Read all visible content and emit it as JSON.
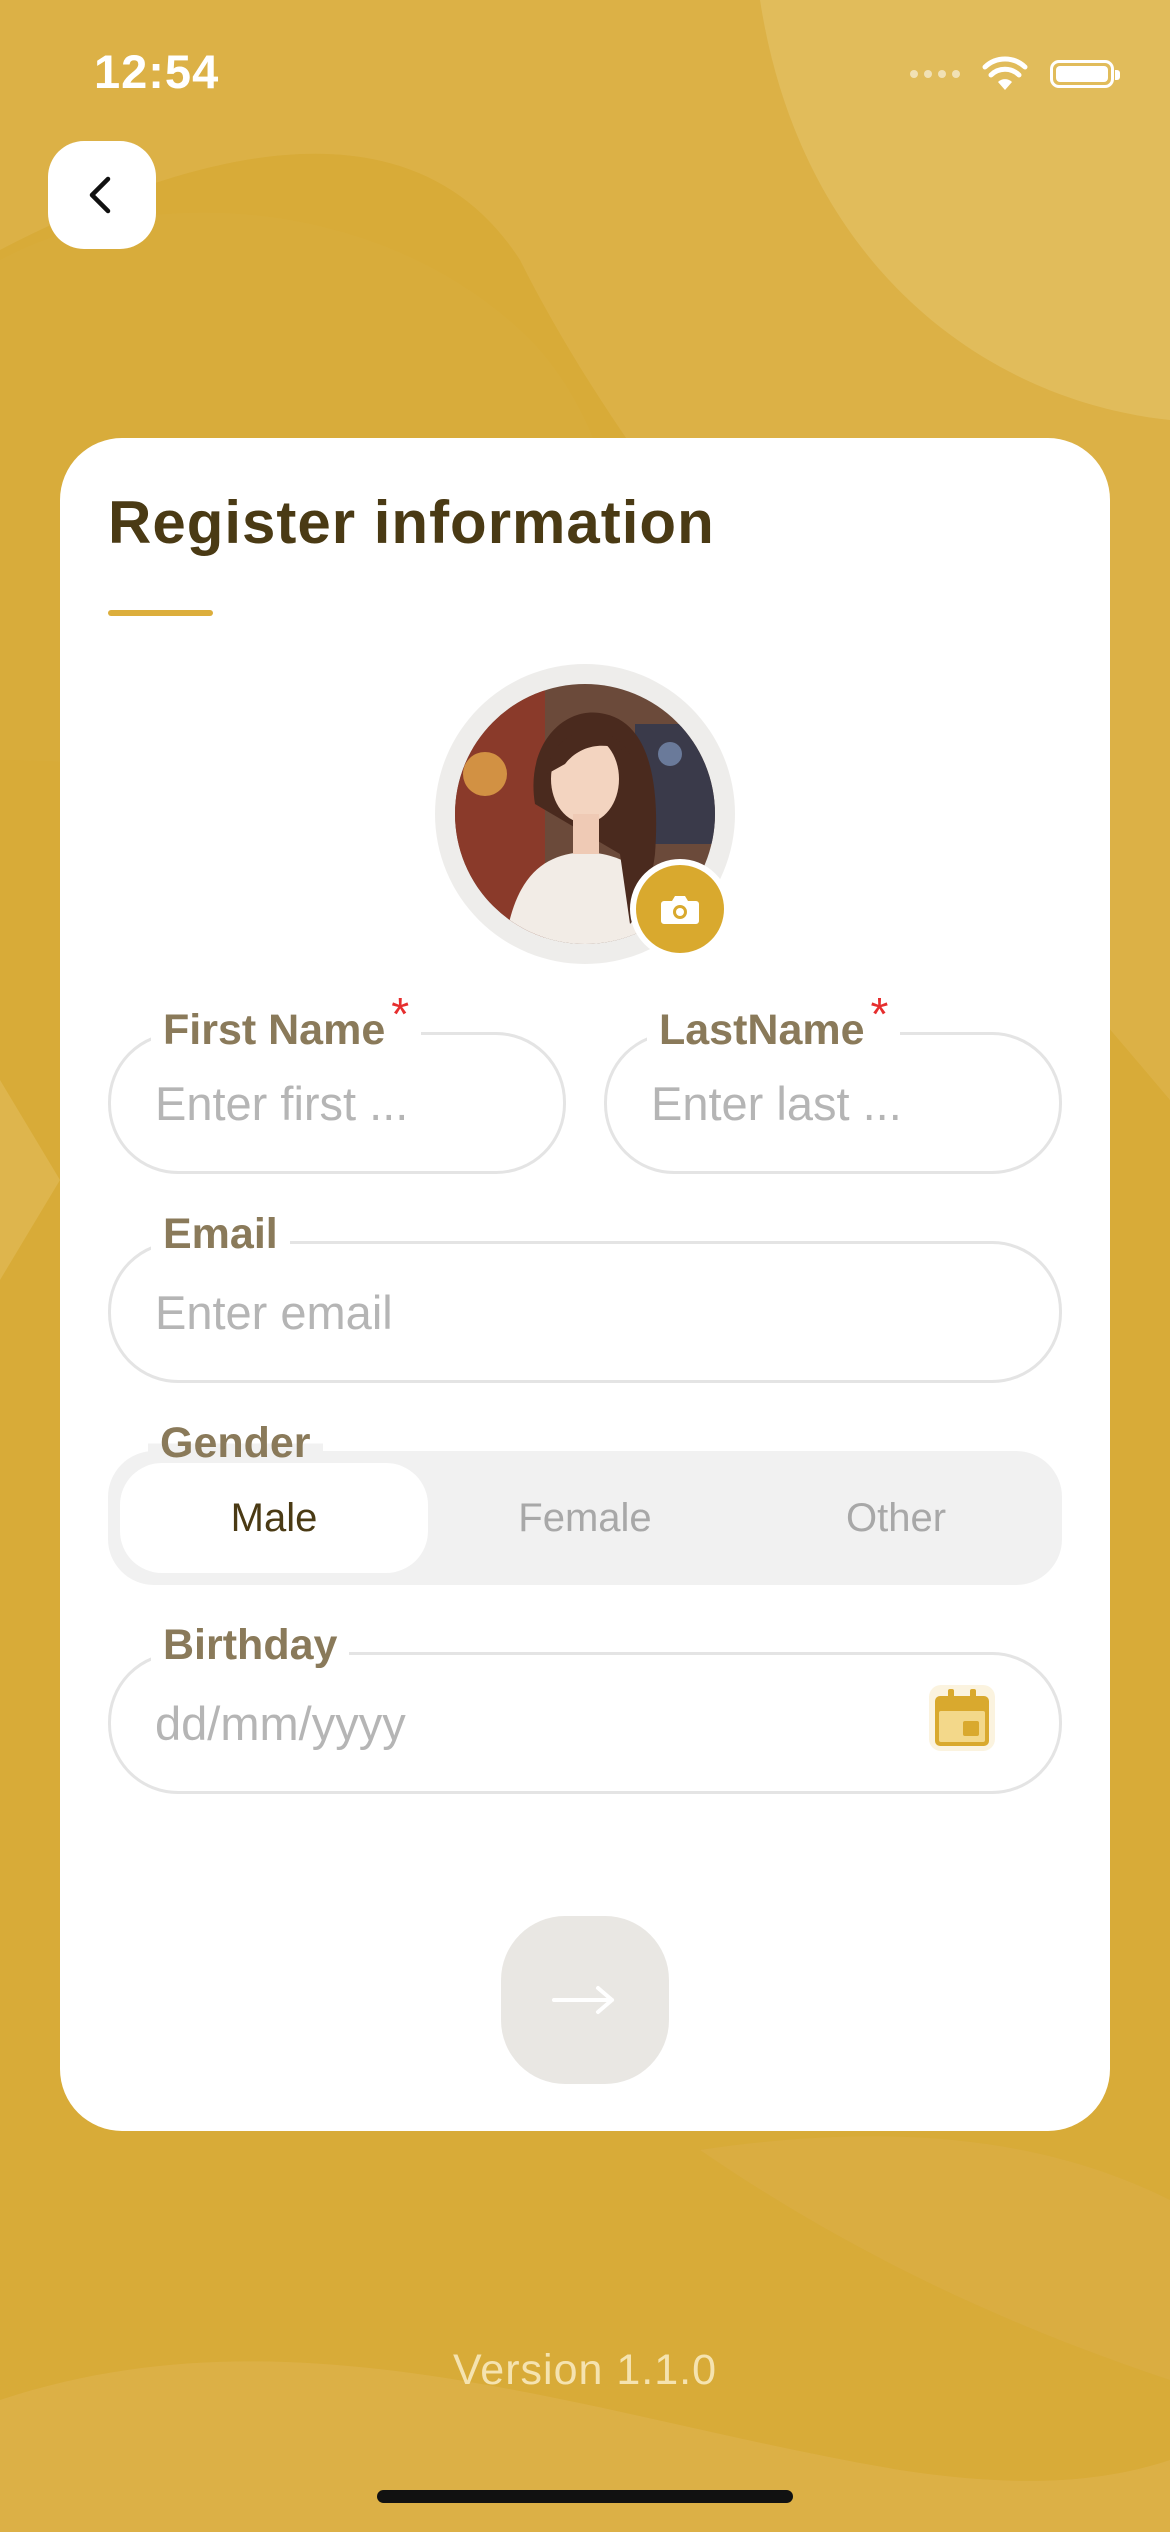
{
  "status_bar": {
    "time": "12:54"
  },
  "colors": {
    "accent": "#dcae3c",
    "title": "#4a3a14",
    "label": "#8a7a5a",
    "required": "#e62e2e",
    "background": "#dcae3c"
  },
  "form": {
    "title": "Register information",
    "first_name": {
      "label": "First Name",
      "required_mark": "*",
      "placeholder": "Enter first ..."
    },
    "last_name": {
      "label": "LastName",
      "required_mark": "*",
      "placeholder": "Enter last ..."
    },
    "email": {
      "label": "Email",
      "placeholder": "Enter email"
    },
    "gender": {
      "label": "Gender",
      "options": [
        "Male",
        "Female",
        "Other"
      ],
      "selected": "Male"
    },
    "birthday": {
      "label": "Birthday",
      "placeholder": "dd/mm/yyyy"
    }
  },
  "icons": {
    "back": "chevron-left-icon",
    "camera": "camera-icon",
    "calendar": "calendar-icon",
    "next": "arrow-right-icon"
  },
  "footer": {
    "version": "Version 1.1.0"
  }
}
